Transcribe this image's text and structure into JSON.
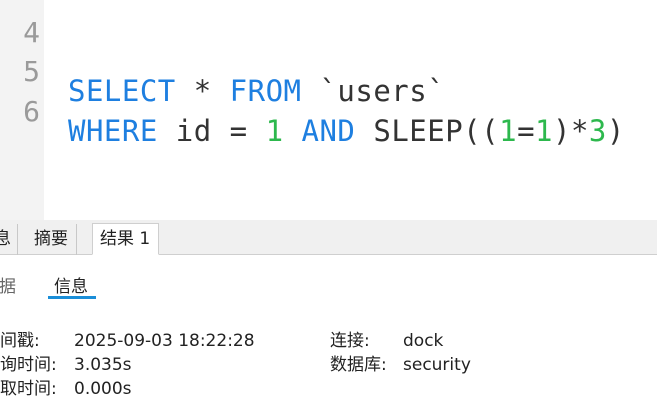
{
  "editor": {
    "lines": [
      {
        "number": "4"
      },
      {
        "number": "5",
        "tokens": [
          "SELECT",
          " * ",
          "FROM",
          " `users`"
        ]
      },
      {
        "number": "6",
        "tokens": [
          "WHERE",
          " id = ",
          "1",
          " ",
          "AND",
          " SLEEP((",
          "1",
          "=",
          "1",
          ")*",
          "3",
          ")"
        ]
      }
    ]
  },
  "colors": {
    "keyword": "#1e7fe0",
    "number": "#2db84d",
    "tab_underline": "#1a8ed8"
  },
  "tabs": {
    "partial": "息",
    "summary": "摘要",
    "result1": "结果 1"
  },
  "subtabs": {
    "data_partial": "据",
    "info": "信息"
  },
  "info": {
    "timestamp_label": "间戳:",
    "timestamp_value": "2025-09-03 18:22:28",
    "query_time_label": "询时间:",
    "query_time_value": "3.035s",
    "fetch_time_label": "取时间:",
    "fetch_time_value": "0.000s",
    "connection_label": "连接:",
    "connection_value": "dock",
    "database_label": "数据库:",
    "database_value": "security"
  }
}
